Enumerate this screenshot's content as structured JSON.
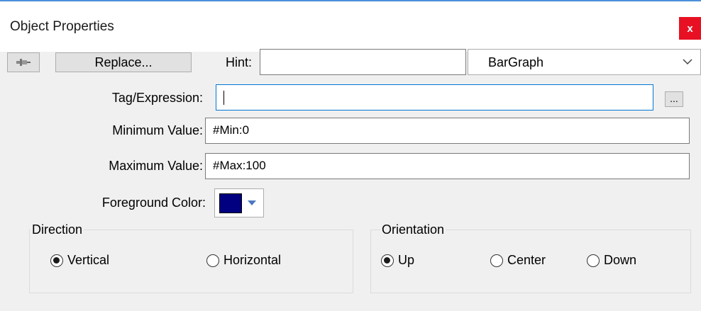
{
  "window": {
    "title": "Object Properties",
    "close_glyph": "x"
  },
  "toolbar": {
    "pin_icon": "pushpin-icon",
    "replace_label": "Replace...",
    "hint_label": "Hint:",
    "hint_value": "",
    "object_type": "BarGraph"
  },
  "fields": {
    "tag_label": "Tag/Expression:",
    "tag_value": "",
    "browse_label": "...",
    "min_label": "Minimum Value:",
    "min_value": "#Min:0",
    "max_label": "Maximum Value:",
    "max_value": "#Max:100",
    "fg_label": "Foreground Color:",
    "fg_color": "#000080"
  },
  "direction": {
    "legend": "Direction",
    "options": [
      {
        "label": "Vertical",
        "checked": true
      },
      {
        "label": "Horizontal",
        "checked": false
      }
    ]
  },
  "orientation": {
    "legend": "Orientation",
    "options": [
      {
        "label": "Up",
        "checked": true
      },
      {
        "label": "Center",
        "checked": false
      },
      {
        "label": "Down",
        "checked": false
      }
    ]
  },
  "colors": {
    "accent": "#0078d7",
    "close": "#e81123",
    "dropdown_arrow": "#4a78c2"
  }
}
